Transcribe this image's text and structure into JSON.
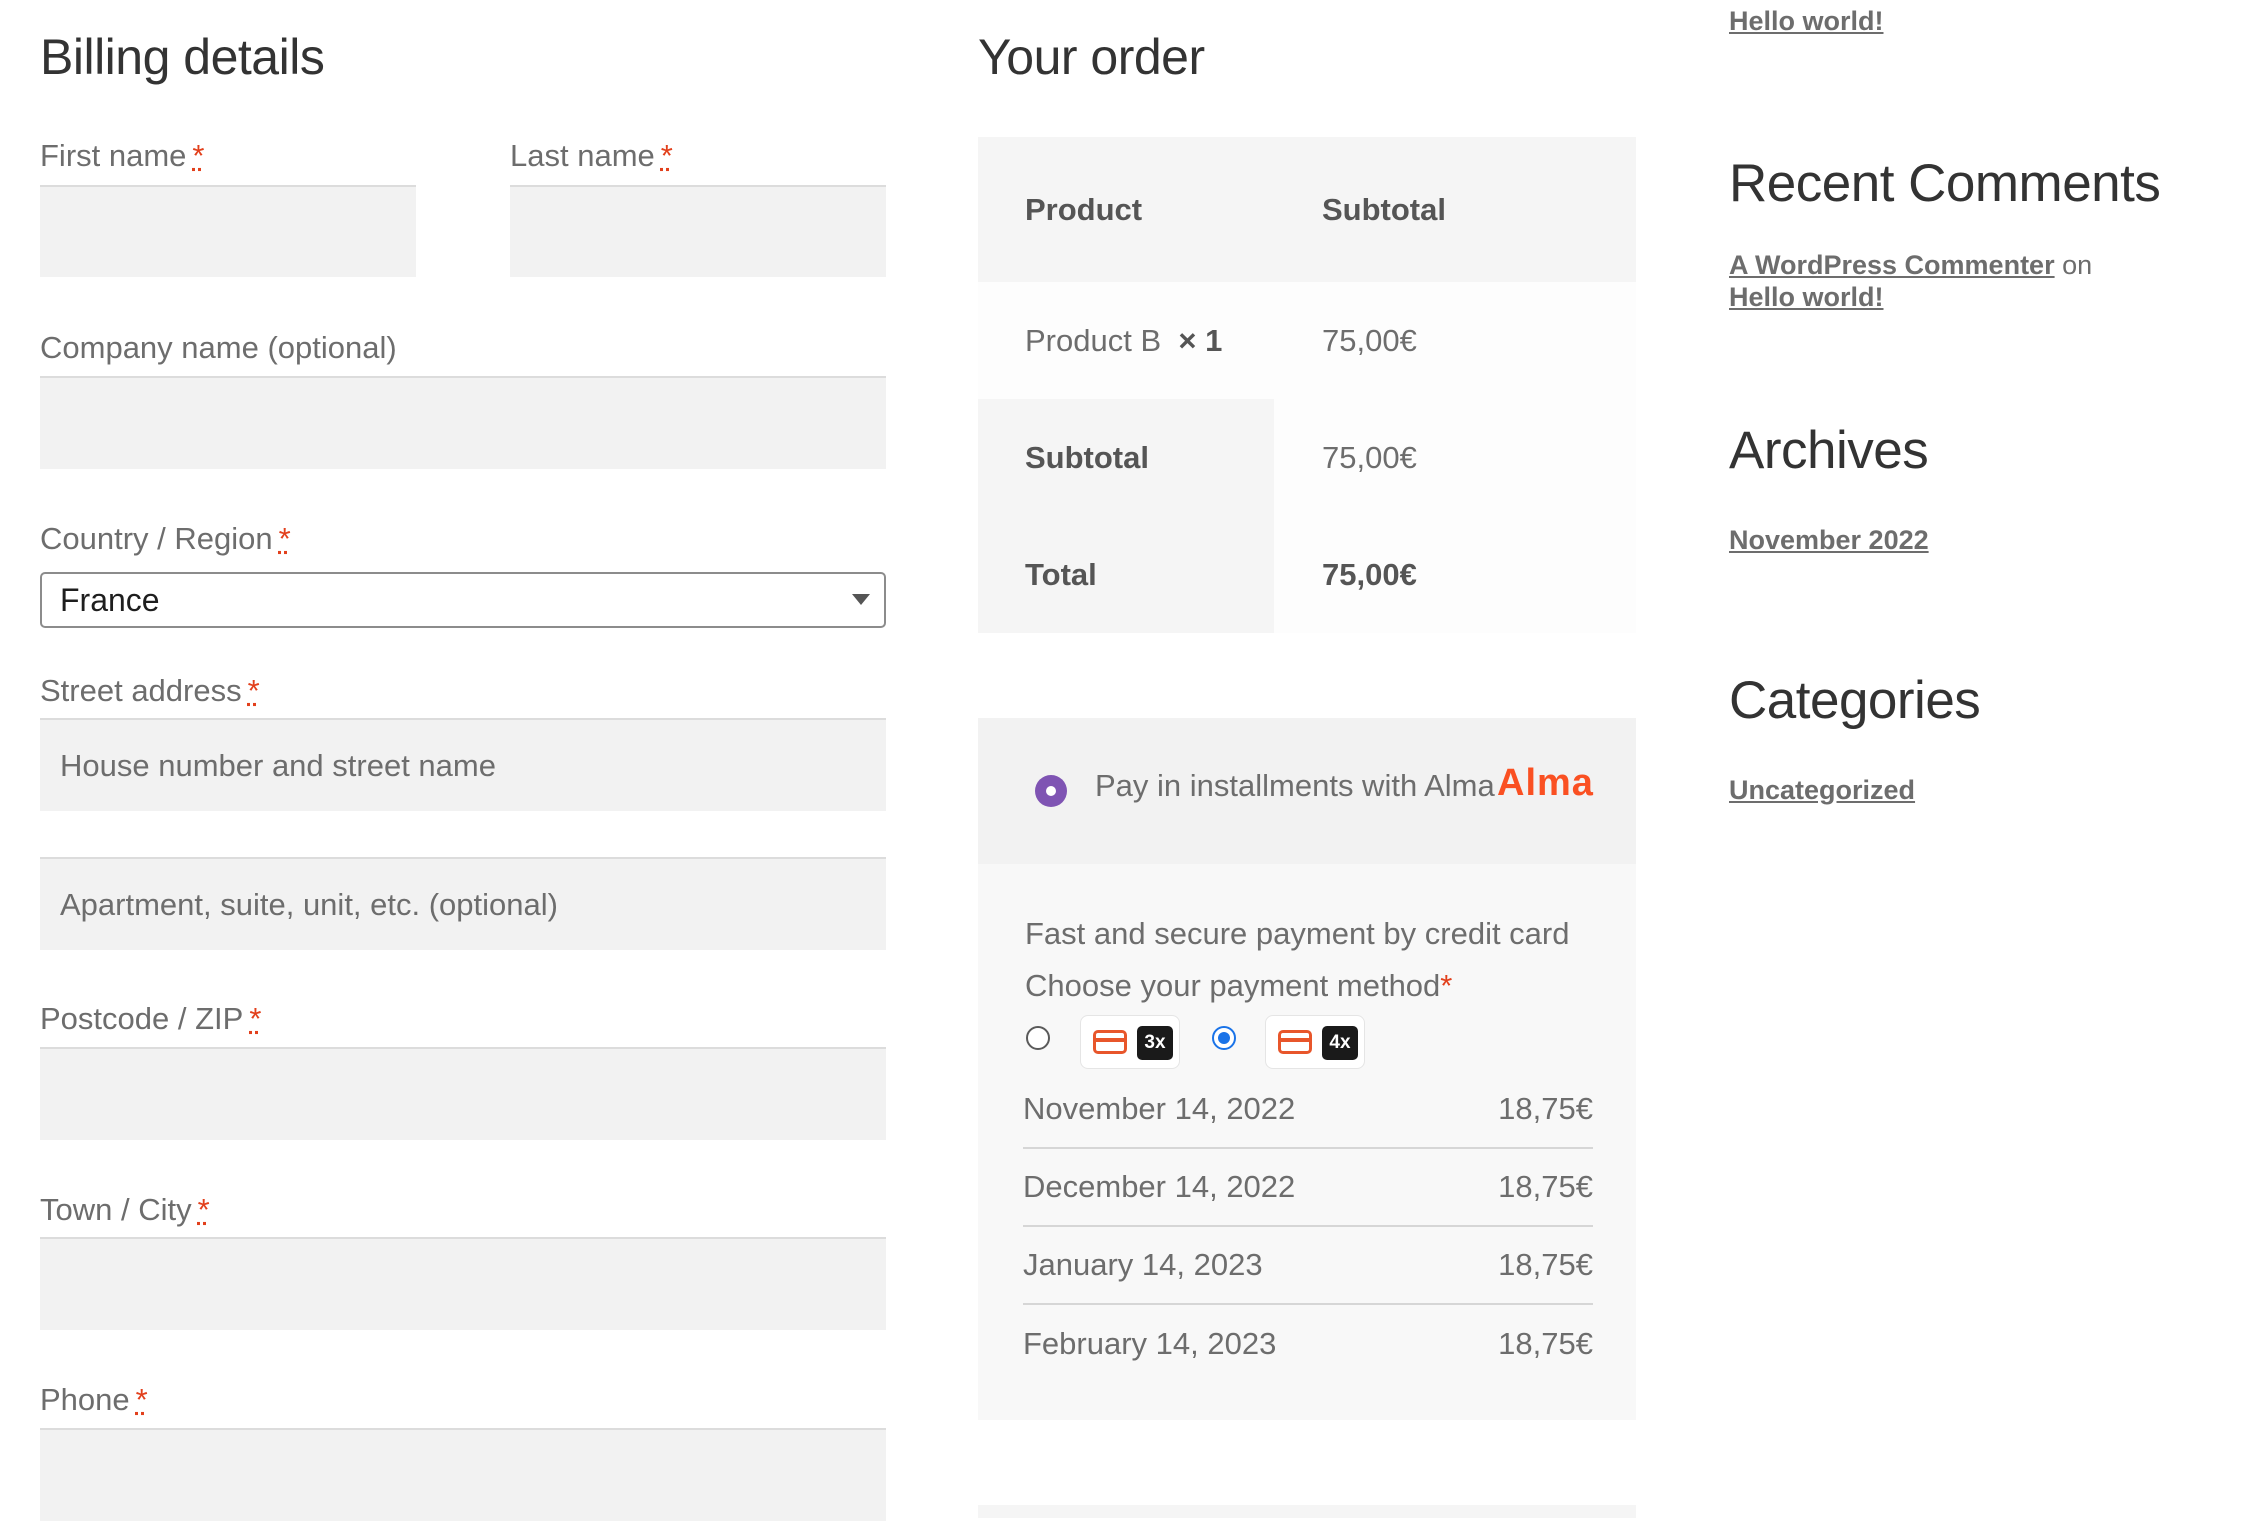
{
  "billing": {
    "title": "Billing details",
    "required_mark": "*",
    "first_name_label": "First name",
    "last_name_label": "Last name",
    "company_label": "Company name (optional)",
    "country_label": "Country / Region",
    "country_value": "France",
    "street_label": "Street address",
    "street_placeholder": "House number and street name",
    "apartment_placeholder": "Apartment, suite, unit, etc. (optional)",
    "postcode_label": "Postcode / ZIP",
    "city_label": "Town / City",
    "phone_label": "Phone"
  },
  "order": {
    "title": "Your order",
    "col_product": "Product",
    "col_subtotal": "Subtotal",
    "item_name": "Product B",
    "item_qty": "× 1",
    "item_price": "75,00€",
    "subtotal_label": "Subtotal",
    "subtotal_value": "75,00€",
    "total_label": "Total",
    "total_value": "75,00€"
  },
  "payment": {
    "option_label": "Pay in installments with Alma",
    "brand": "Alma",
    "description": "Fast and secure payment by credit card",
    "choose_label": "Choose your payment method",
    "choose_required": "*",
    "plans": [
      {
        "label": "3x",
        "selected": false
      },
      {
        "label": "4x",
        "selected": true
      }
    ],
    "installments": [
      {
        "date": "November 14, 2022",
        "amount": "18,75€"
      },
      {
        "date": "December 14, 2022",
        "amount": "18,75€"
      },
      {
        "date": "January 14, 2023",
        "amount": "18,75€"
      },
      {
        "date": "February 14, 2023",
        "amount": "18,75€"
      }
    ],
    "colors": {
      "accent": "#1a73e8",
      "radio_purple": "#7f54b3",
      "alma_orange": "#fa5022",
      "required_red": "#e2401c"
    }
  },
  "sidebar": {
    "top_link": "Hello world!",
    "recent_comments_title": "Recent Comments",
    "comment_author": "A WordPress Commenter",
    "comment_on": "on",
    "comment_post": "Hello world!",
    "archives_title": "Archives",
    "archive_link": "November 2022",
    "categories_title": "Categories",
    "category_link": "Uncategorized"
  }
}
